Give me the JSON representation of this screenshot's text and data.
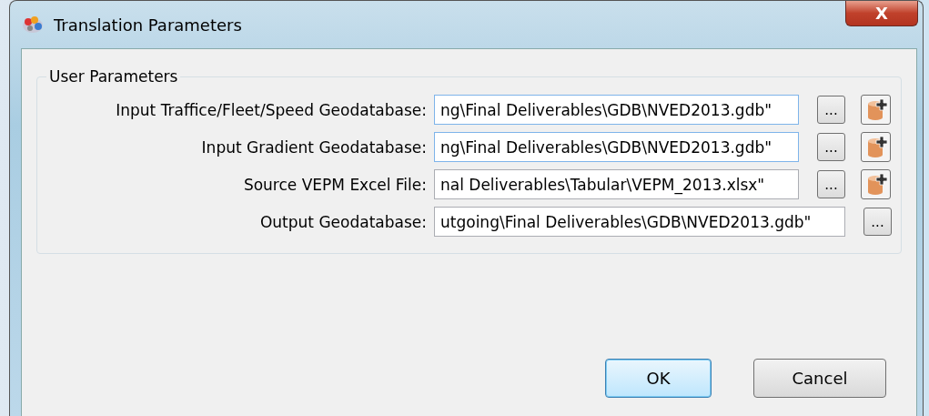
{
  "window": {
    "title": "Translation Parameters",
    "close_label": "X"
  },
  "group": {
    "title": "User Parameters"
  },
  "parameters": [
    {
      "label": "Input Traffice/Fleet/Speed Geodatabase:",
      "value": "ng\\Final Deliverables\\GDB\\NVED2013.gdb\"",
      "kind": "with-add",
      "highlighted": true,
      "browse_label": "..."
    },
    {
      "label": "Input Gradient Geodatabase:",
      "value": "ng\\Final Deliverables\\GDB\\NVED2013.gdb\"",
      "kind": "with-add",
      "highlighted": true,
      "browse_label": "..."
    },
    {
      "label": "Source VEPM Excel File:",
      "value": "nal Deliverables\\Tabular\\VEPM_2013.xlsx\"",
      "kind": "with-add",
      "highlighted": false,
      "browse_label": "..."
    },
    {
      "label": "Output Geodatabase:",
      "value": "utgoing\\Final Deliverables\\GDB\\NVED2013.gdb\"",
      "kind": "plain",
      "highlighted": false,
      "browse_label": "..."
    }
  ],
  "buttons": [
    {
      "label": "OK",
      "default": true
    },
    {
      "label": "Cancel",
      "default": false
    }
  ]
}
